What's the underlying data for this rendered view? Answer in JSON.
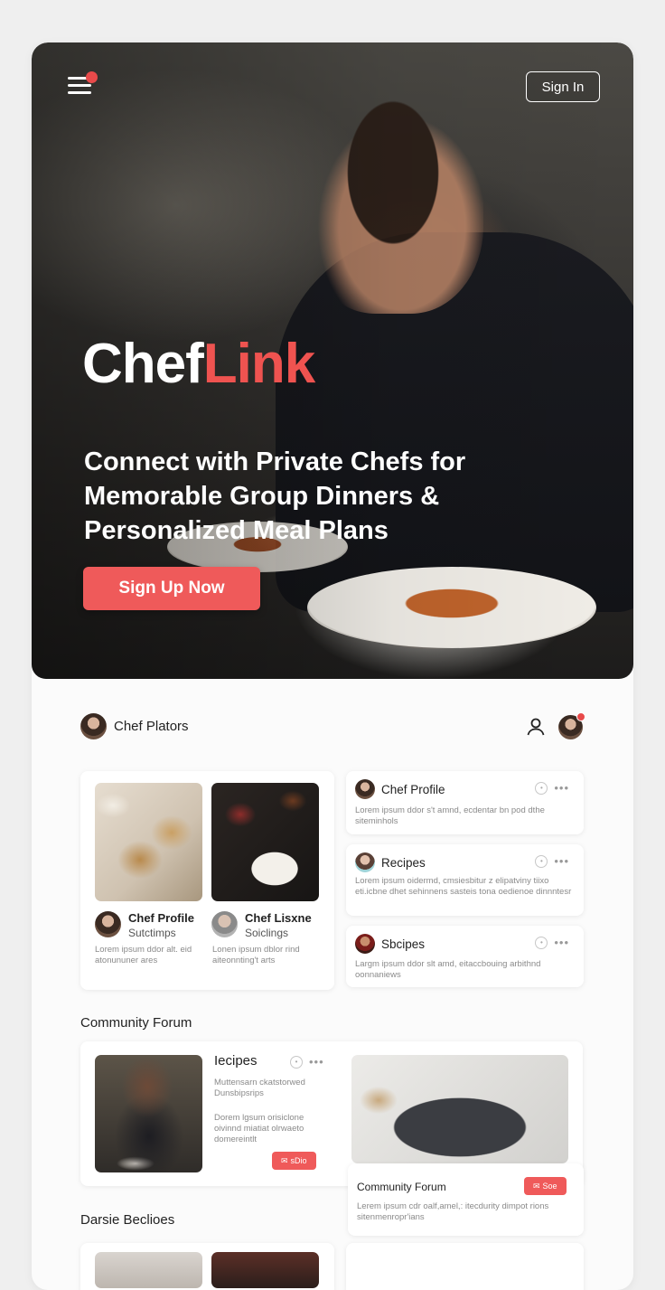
{
  "header": {
    "sign_in_label": "Sign In"
  },
  "hero": {
    "brand_main": "Chef",
    "brand_accent": "Link",
    "tagline": "Connect with Private Chefs for Memorable Group Dinners & Personalized Meal Plans",
    "cta_label": "Sign Up Now"
  },
  "topbar": {
    "user_name": "Chef Plators"
  },
  "featured": {
    "chef1": {
      "title": "Chef Profile",
      "subtitle": "Sutctimps",
      "desc": "Lorem ipsum ddor alt. eid atonununer ares"
    },
    "chef2": {
      "title": "Chef Lisxne",
      "subtitle": "Soiclings",
      "desc": "Lonen ipsum dblor rind aiteonnting't arts"
    }
  },
  "side_cards": [
    {
      "title": "Chef Profile",
      "desc": "Lorem ipsum ddor s't amnd, ecdentar bn pod dthe siteminhols"
    },
    {
      "title": "Recipes",
      "desc": "Lorem ipsum oidermd, cmsiesbitur z elipatviny tiixo eti.icbne dhet sehinnens sasteis tona oedienoe dinnntesr"
    },
    {
      "title": "Sbcipes",
      "desc": "Largm ipsum ddor slt amd, eitaccbouing arbithnd oonnaniews"
    }
  ],
  "community": {
    "section_title": "Community Forum",
    "post_title": "Iecipes",
    "post_meta": "Muttensarn ckatstorwed Dunsbipsrips",
    "post_desc": "Dorem lgsum orisiclone oivinnd miatiat olrwaeto domereintlt",
    "post_button": "sDio",
    "right_title": "Community Forum",
    "right_button": "Soe",
    "right_desc": "Lerem ipsum cdr oalf,amel,: itecdurity dimpot rions sitenmenropr'ians"
  },
  "bottom": {
    "section_title": "Darsie Beclioes"
  },
  "colors": {
    "accent": "#ef5a5a",
    "notification": "#e84a4a"
  }
}
